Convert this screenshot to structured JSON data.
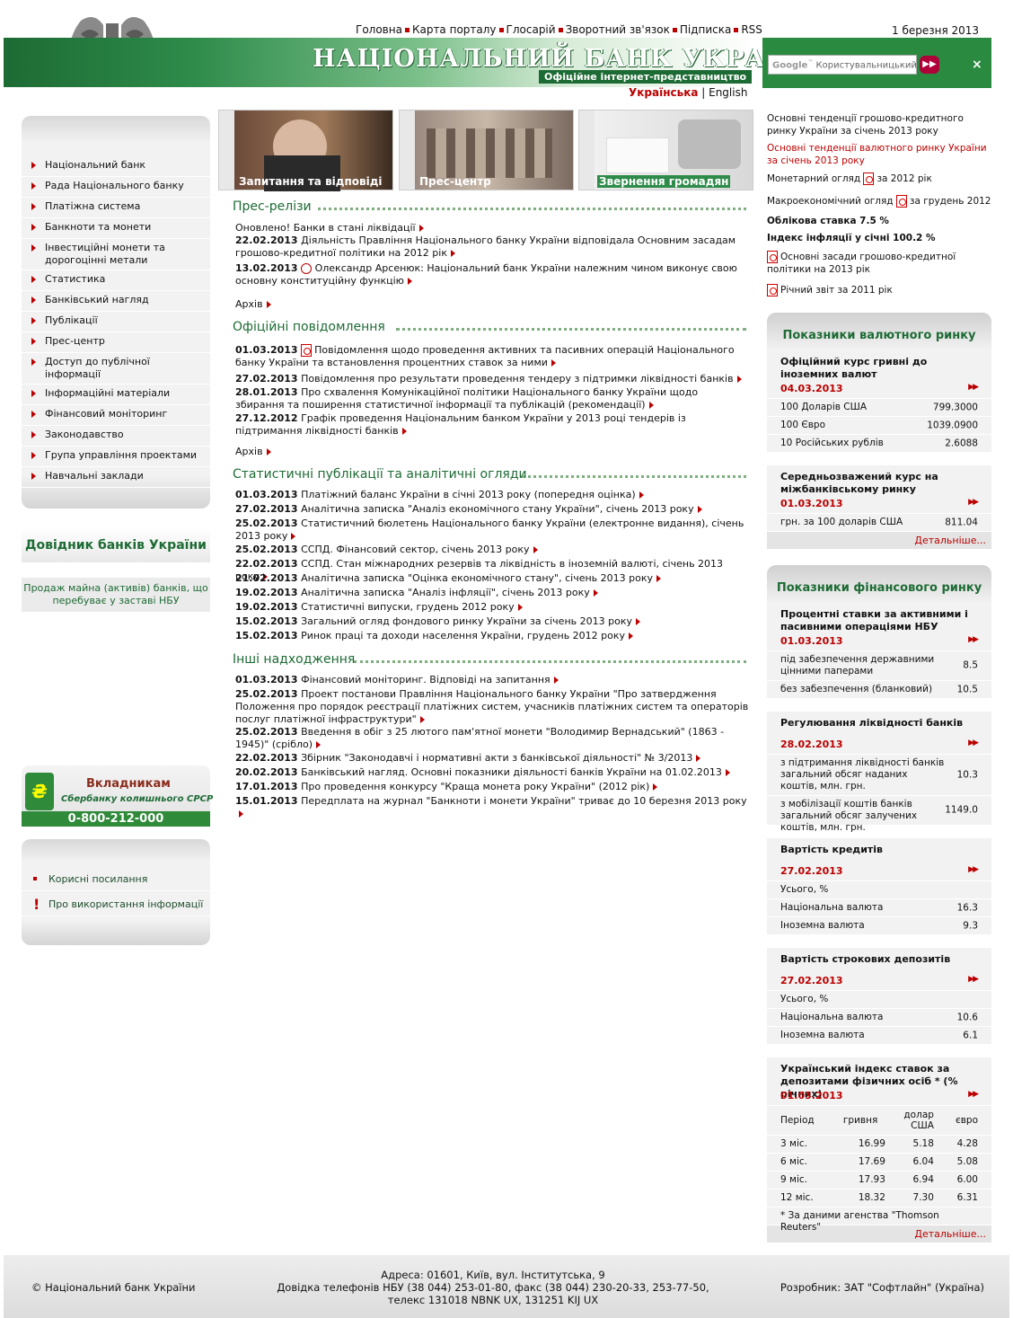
{
  "header": {
    "nav": [
      "Головна",
      "Карта порталу",
      "Глосарій",
      "Зворотний зв'язок",
      "Підписка",
      "RSS"
    ],
    "date": "1 березня 2013",
    "title": "НАЦІОНАЛЬНИЙ БАНК УКРАЇНИ",
    "subtitle": "Офіційне інтернет-представництво",
    "search_placeholder": "Користувальницький пошук",
    "lang_active": "Українська",
    "lang_other": "English"
  },
  "leftnav": [
    "Національний банк",
    "Рада Національного банку",
    "Платіжна система",
    "Банкноти та монети",
    "Інвестиційні монети та дорогоцінні метали",
    "Статистика",
    "Банківський нагляд",
    "Публікації",
    "Прес-центр",
    "Доступ до публічної інформації",
    "Інформаційні матеріали",
    "Фінансовий моніторинг",
    "Законодавство",
    "Група управління проектами",
    "Навчальні заклади"
  ],
  "dovidnyk": "Довідник банків України",
  "prodazh": "Продаж майна (активів) банків, що перебуває у заставі НБУ",
  "vklad": {
    "title": "Вкладникам",
    "sub": "Сбербанку колишнього СРСР",
    "phone": "0-800-212-000"
  },
  "links": [
    "Корисні посилання",
    "Про використання інформації"
  ],
  "photos": [
    "Запитання та відповіді",
    "Прес-центр",
    "Звернення громадян"
  ],
  "sections": {
    "press": {
      "title": "Прес-релізи",
      "items": [
        {
          "date": "",
          "text": "Оновлено! Банки в стані ліквідації"
        },
        {
          "date": "22.02.2013",
          "text": "Діяльність Правління Національного банку України відповідала Основним засадам грошово-кредитної політики на 2012 рік"
        },
        {
          "date": "13.02.2013",
          "text": "Олександр Арсенюк: Національний банк України належним чином виконує свою основну конституційну функцію"
        }
      ],
      "archive": "Архів"
    },
    "official": {
      "title": "Офіційні повідомлення",
      "items": [
        {
          "date": "01.03.2013",
          "text": "Повідомлення щодо проведення активних та пасивних операцій Національного банку України та встановлення процентних ставок за ними"
        },
        {
          "date": "27.02.2013",
          "text": "Повідомлення про результати проведення тендеру з підтримки ліквідності банків"
        },
        {
          "date": "28.01.2013",
          "text": "Про схвалення Комунікаційної політики Національного банку України щодо збирання та поширення статистичної інформації та публікацій (рекомендації)"
        },
        {
          "date": "27.12.2012",
          "text": "Графік проведення Національним банком України у 2013 році тендерів із підтримання ліквідності банків"
        }
      ],
      "archive": "Архів"
    },
    "stat": {
      "title": "Статистичні публікації та аналітичні огляди",
      "items": [
        {
          "date": "01.03.2013",
          "text": "Платіжний баланс України в січні 2013 року (попередня оцінка)"
        },
        {
          "date": "27.02.2013",
          "text": "Аналітична записка \"Аналіз економічного стану України\", січень 2013 року"
        },
        {
          "date": "25.02.2013",
          "text": "Статистичний бюлетень Національного банку України (електронне видання), січень 2013 року"
        },
        {
          "date": "25.02.2013",
          "text": "ССПД. Фінансовий сектор, січень 2013 року"
        },
        {
          "date": "22.02.2013",
          "text": "ССПД. Стан міжнародних резервів та ліквідність в іноземній валюті, січень 2013 року"
        },
        {
          "date": "21.02.2013",
          "text": "Аналітична записка \"Оцінка економічного стану\", січень 2013 року"
        },
        {
          "date": "19.02.2013",
          "text": "Аналітична записка \"Аналіз інфляції\", січень 2013 року"
        },
        {
          "date": "19.02.2013",
          "text": "Статистичні випуски, грудень 2012 року"
        },
        {
          "date": "15.02.2013",
          "text": "Загальний огляд фондового ринку України за січень 2013 року"
        },
        {
          "date": "15.02.2013",
          "text": "Ринок праці та доходи населення України, грудень 2012 року"
        }
      ]
    },
    "other": {
      "title": "Інші надходження",
      "items": [
        {
          "date": "01.03.2013",
          "text": "Фінансовий моніторинг. Відповіді на запитання"
        },
        {
          "date": "25.02.2013",
          "text": "Проект постанови Правління Національного банку України \"Про затвердження Положення про порядок реєстрації платіжних систем, учасників платіжних систем та операторів послуг платіжної інфраструктури\""
        },
        {
          "date": "25.02.2013",
          "text": "Введення в обіг з 25 лютого пам'ятної монети \"Володимир Вернадський\" (1863 - 1945)\" (срібло)"
        },
        {
          "date": "22.02.2013",
          "text": "Збірник \"Законодавчі і нормативні акти з банківської діяльності\" № 3/2013"
        },
        {
          "date": "20.02.2013",
          "text": "Банківський нагляд. Основні показники діяльності банків України на 01.02.2013"
        },
        {
          "date": "17.01.2013",
          "text": "Про проведення конкурсу \"Краща монета року України\" (2012 рік)"
        },
        {
          "date": "15.01.2013",
          "text": "Передплата на журнал \"Банкноти і монети України\" триває до 10 березня 2013 року"
        }
      ]
    }
  },
  "right_top": [
    {
      "text": "Основні тенденції грошово-кредитного ринку України за січень 2013 року",
      "style": "plain"
    },
    {
      "text": "Основні тенденції валютного ринку України за січень 2013 року",
      "style": "red"
    },
    {
      "label": "Монетарний огляд",
      "text": "за 2012 рік",
      "style": "pdf"
    },
    {
      "label": "Макроекономічний огляд",
      "text": "за грудень 2012",
      "style": "pdf"
    },
    {
      "text": "Облікова ставка 7.5 %",
      "style": "bold"
    },
    {
      "text": "Індекс інфляції у січні 100.2 %",
      "style": "bold"
    },
    {
      "text": "Основні засади грошово-кредитної політики на 2013 рік",
      "style": "pdfblock"
    },
    {
      "text": "Річний звіт за 2011 рік",
      "style": "pdfblock"
    }
  ],
  "fx": {
    "title": "Показники валютного ринку",
    "official": {
      "label": "Офіційний курс гривні до іноземних валют",
      "date": "04.03.2013",
      "rows": [
        [
          "100 Доларів США",
          "799.3000"
        ],
        [
          "100 Євро",
          "1039.0900"
        ],
        [
          "10 Російських рублів",
          "2.6088"
        ]
      ]
    },
    "interbank": {
      "label": "Середньозважений курс на міжбанківському ринку",
      "date": "01.03.2013",
      "rows": [
        [
          "грн. за 100 доларів США",
          "811.04"
        ]
      ]
    },
    "more": "Детальніше..."
  },
  "fin": {
    "title": "Показники фінансового ринку",
    "rates": {
      "label": "Процентні ставки за активними і пасивними операціями НБУ",
      "date": "01.03.2013",
      "rows": [
        [
          "під забезпечення державними цінними паперами",
          "8.5"
        ],
        [
          "без забезпечення (бланковий)",
          "10.5"
        ]
      ]
    },
    "liquidity": {
      "label": "Регулювання ліквідності банків",
      "date": "28.02.2013",
      "rows": [
        [
          "з підтримання ліквідності банків загальний обсяг наданих коштів, млн. грн.",
          "10.3"
        ],
        [
          "з мобілізації коштів банків загальний обсяг залучених коштів, млн. грн.",
          "1149.0"
        ]
      ]
    },
    "credits": {
      "label": "Вартість кредитів",
      "date": "27.02.2013",
      "rows": [
        [
          "Усього, %",
          ""
        ],
        [
          "Національна валюта",
          "16.3"
        ],
        [
          "Іноземна валюта",
          "9.3"
        ]
      ]
    },
    "deposits": {
      "label": "Вартість строкових депозитів",
      "date": "27.02.2013",
      "rows": [
        [
          "Усього, %",
          ""
        ],
        [
          "Національна валюта",
          "10.6"
        ],
        [
          "Іноземна валюта",
          "6.1"
        ]
      ]
    },
    "index": {
      "label": "Український індекс ставок за депозитами фізичних осіб * (% річних)",
      "date": "01.03.2013",
      "head": [
        "Період",
        "гривня",
        "долар США",
        "євро"
      ],
      "rows": [
        [
          "3 міс.",
          "16.99",
          "5.18",
          "4.28"
        ],
        [
          "6 міс.",
          "17.69",
          "6.04",
          "5.08"
        ],
        [
          "9 міс.",
          "17.93",
          "6.94",
          "6.00"
        ],
        [
          "12 міс.",
          "18.32",
          "7.30",
          "6.31"
        ]
      ],
      "note": "* За даними агенства \"Thomson Reuters\""
    },
    "more": "Детальніше..."
  },
  "footer": {
    "copy": "© Національний банк України",
    "addr1": "Адреса: 01601, Київ, вул. Інститутська, 9",
    "addr2": "Довідка телефонів НБУ (38 044) 253-01-80, факс (38 044) 230-20-33, 253-77-50,",
    "addr3": "телекс 131018 NBNK UX, 131251 KIJ UX",
    "dev": "Розробник: ЗАТ \"Софтлайн\" (Україна)"
  }
}
